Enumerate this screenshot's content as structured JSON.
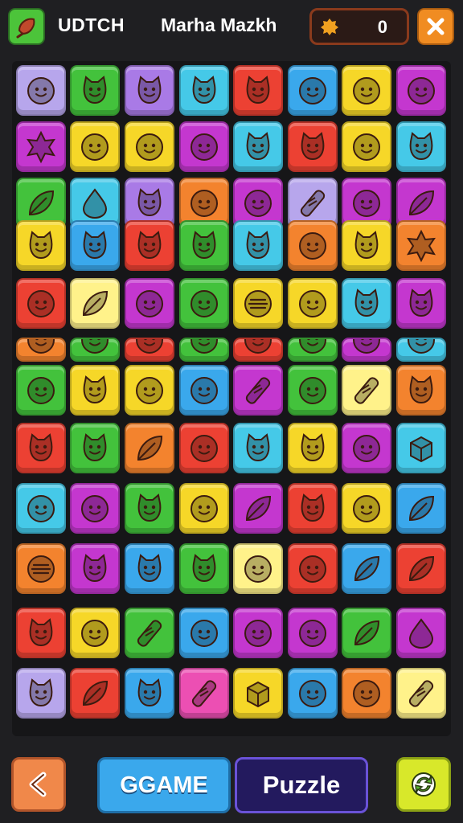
{
  "header": {
    "left_title": "UDTCH",
    "center_title": "Marha Mazkh",
    "score": "0",
    "icons": {
      "app": "food-icon",
      "score": "coin-icon",
      "close": "close-icon"
    }
  },
  "footer": {
    "game_label": "GGAME",
    "puzzle_label": "Puzzle",
    "icons": {
      "back": "back-icon",
      "refresh": "refresh-icon"
    }
  },
  "colors": {
    "purple": "#a97ae6",
    "green": "#43c23c",
    "blue": "#3aa8ec",
    "cyan": "#45c9e8",
    "red": "#ec4133",
    "orange": "#f3832e",
    "yellow": "#f6d728",
    "magenta": "#c437cf",
    "pink": "#ec4fb3",
    "lavender": "#b7a6ec",
    "dgreen": "#58b92f",
    "lyellow": "#fff28a"
  },
  "board": {
    "rows": [
      [
        [
          "lavender",
          "face"
        ],
        [
          "green",
          "cat"
        ],
        [
          "purple",
          "cat"
        ],
        [
          "cyan",
          "cat"
        ],
        [
          "red",
          "cat"
        ],
        [
          "blue",
          "face"
        ],
        [
          "yellow",
          "face"
        ],
        [
          "magenta",
          "face"
        ]
      ],
      [
        [
          "magenta",
          "star"
        ],
        [
          "yellow",
          "face"
        ],
        [
          "yellow",
          "face"
        ],
        [
          "magenta",
          "face"
        ],
        [
          "cyan",
          "cat"
        ],
        [
          "red",
          "cat"
        ],
        [
          "yellow",
          "face"
        ],
        [
          "cyan",
          "cat"
        ]
      ],
      [
        [
          "green",
          "leaf"
        ],
        [
          "cyan",
          "drop"
        ],
        [
          "purple",
          "cat"
        ],
        [
          "orange",
          "face"
        ],
        [
          "magenta",
          "face"
        ],
        [
          "lavender",
          "stick"
        ],
        [
          "magenta",
          "face"
        ],
        [
          "magenta",
          "leaf"
        ]
      ],
      [
        [
          "yellow",
          "cat"
        ],
        [
          "blue",
          "cat"
        ],
        [
          "red",
          "cat"
        ],
        [
          "green",
          "cat"
        ],
        [
          "cyan",
          "cat"
        ],
        [
          "orange",
          "face"
        ],
        [
          "yellow",
          "cat"
        ],
        [
          "orange",
          "star"
        ]
      ],
      [
        [
          "red",
          "face"
        ],
        [
          "lyellow",
          "leaf"
        ],
        [
          "magenta",
          "face"
        ],
        [
          "green",
          "face"
        ],
        [
          "yellow",
          "stripe"
        ],
        [
          "yellow",
          "face"
        ],
        [
          "cyan",
          "cat"
        ],
        [
          "magenta",
          "cat"
        ]
      ],
      [
        [
          "orange",
          "face"
        ],
        [
          "green",
          "face"
        ],
        [
          "red",
          "face"
        ],
        [
          "green",
          "face"
        ],
        [
          "red",
          "face"
        ],
        [
          "green",
          "face"
        ],
        [
          "magenta",
          "face"
        ],
        [
          "cyan",
          "face"
        ]
      ],
      [
        [
          "green",
          "face"
        ],
        [
          "yellow",
          "cat"
        ],
        [
          "yellow",
          "face"
        ],
        [
          "blue",
          "face"
        ],
        [
          "magenta",
          "stick"
        ],
        [
          "green",
          "face"
        ],
        [
          "lyellow",
          "stick"
        ],
        [
          "orange",
          "cat"
        ]
      ],
      [
        [
          "red",
          "cat"
        ],
        [
          "green",
          "cat"
        ],
        [
          "orange",
          "leaf"
        ],
        [
          "red",
          "face"
        ],
        [
          "cyan",
          "cat"
        ],
        [
          "yellow",
          "cat"
        ],
        [
          "magenta",
          "face"
        ],
        [
          "cyan",
          "box"
        ]
      ],
      [
        [
          "cyan",
          "face"
        ],
        [
          "magenta",
          "face"
        ],
        [
          "green",
          "cat"
        ],
        [
          "yellow",
          "face"
        ],
        [
          "magenta",
          "leaf"
        ],
        [
          "red",
          "cat"
        ],
        [
          "yellow",
          "face"
        ],
        [
          "blue",
          "leaf"
        ]
      ],
      [
        [
          "orange",
          "stripe"
        ],
        [
          "magenta",
          "cat"
        ],
        [
          "blue",
          "cat"
        ],
        [
          "green",
          "cat"
        ],
        [
          "lyellow",
          "face"
        ],
        [
          "red",
          "face"
        ],
        [
          "blue",
          "leaf"
        ],
        [
          "red",
          "leaf"
        ]
      ],
      [
        [
          "red",
          "cat"
        ],
        [
          "yellow",
          "face"
        ],
        [
          "green",
          "stick"
        ],
        [
          "blue",
          "face"
        ],
        [
          "magenta",
          "face"
        ],
        [
          "magenta",
          "face"
        ],
        [
          "green",
          "leaf"
        ],
        [
          "magenta",
          "drop"
        ]
      ],
      [
        [
          "lavender",
          "cat"
        ],
        [
          "red",
          "leaf"
        ],
        [
          "blue",
          "cat"
        ],
        [
          "pink",
          "stick"
        ],
        [
          "yellow",
          "box"
        ],
        [
          "blue",
          "face"
        ],
        [
          "orange",
          "face"
        ],
        [
          "lyellow",
          "stick"
        ]
      ]
    ]
  }
}
